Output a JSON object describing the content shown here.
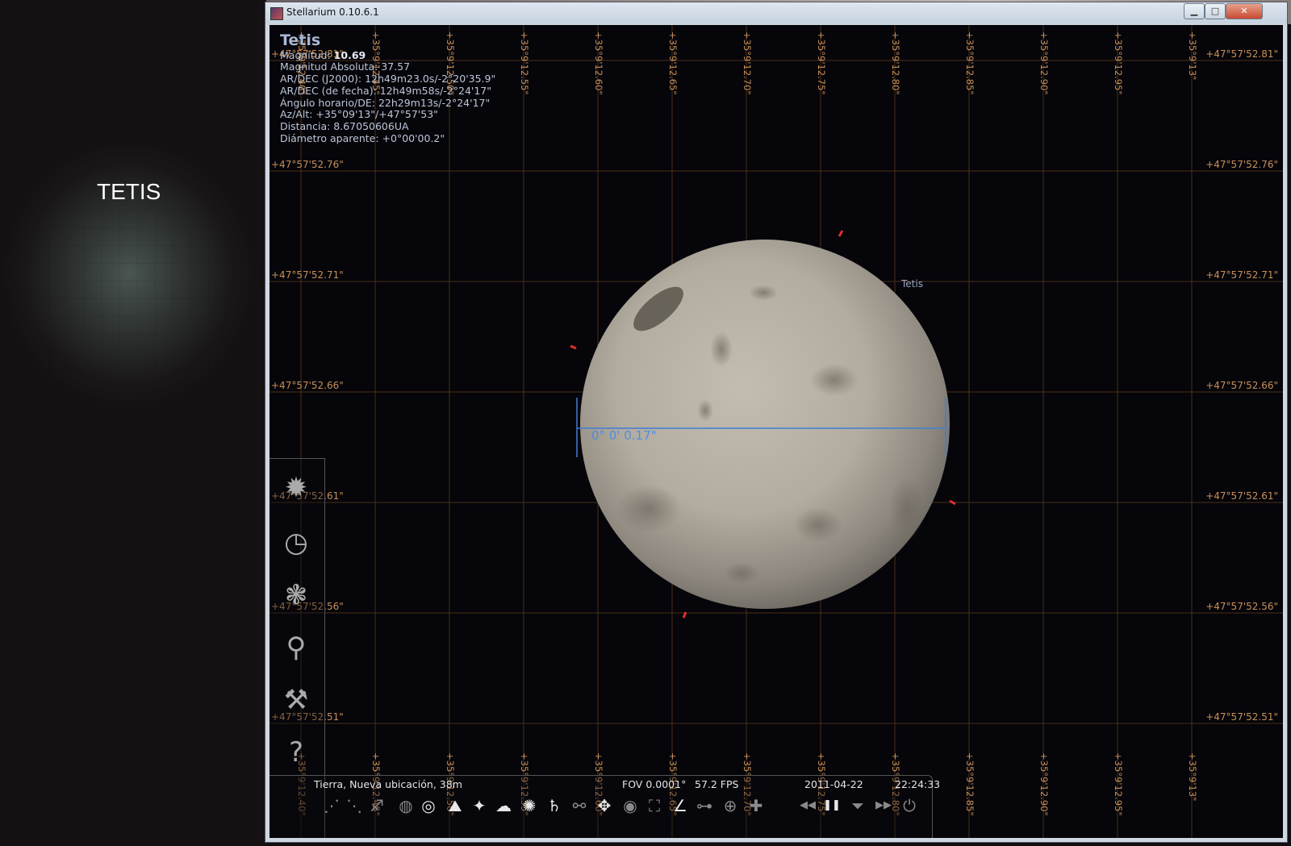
{
  "left_panel": {
    "title": "TETIS"
  },
  "window": {
    "title": "Stellarium 0.10.6.1",
    "min_label": "▁",
    "max_label": "□",
    "close_label": "✕"
  },
  "object_info": {
    "name": "Tetis",
    "magnitude_label": "Magnitud: ",
    "magnitude_value": "10.69",
    "lines": [
      "Magnitud Absoluta: 37.57",
      "AR/DEC (J2000): 12h49m23.0s/-2°20'35.9\"",
      "AR/DEC (de fecha): 12h49m58s/-2°24'17\"",
      "Ángulo horario/DE: 22h29m13s/-2°24'17\"",
      "Az/Alt: +35°09'13\"/+47°57'53\"",
      "Distancia: 8.67050606UA",
      "Diámetro aparente: +0°00'00.2\""
    ]
  },
  "sky": {
    "object_label": "Tetis",
    "measurement": "0° 0' 0.17\"",
    "alt_grid_labels": [
      "+47°57'52.81\"",
      "+47°57'52.76\"",
      "+47°57'52.71\"",
      "+47°57'52.66\"",
      "+47°57'52.61\"",
      "+47°57'52.56\"",
      "+47°57'52.51\""
    ],
    "az_grid_labels": [
      "+35°9'12.40\"",
      "+35°9'12.45\"",
      "+35°9'12.50\"",
      "+35°9'12.55\"",
      "+35°9'12.60\"",
      "+35°9'12.65\"",
      "+35°9'12.70\"",
      "+35°9'12.75\"",
      "+35°9'12.80\"",
      "+35°9'12.85\"",
      "+35°9'12.90\"",
      "+35°9'12.95\"",
      "+35°9'13\""
    ],
    "colors": {
      "grid_line": "#4a3018",
      "grid_label": "#c89058",
      "measure": "#3f7fd6",
      "marker": "#e03030"
    }
  },
  "sidebar": {
    "items": [
      {
        "name": "location-window-icon",
        "glyph": "✹"
      },
      {
        "name": "date-time-window-icon",
        "glyph": "◷"
      },
      {
        "name": "sky-viewing-options-icon",
        "glyph": "❃"
      },
      {
        "name": "search-window-icon",
        "glyph": "⚲"
      },
      {
        "name": "configuration-window-icon",
        "glyph": "⚒"
      },
      {
        "name": "help-window-icon",
        "glyph": "?"
      }
    ]
  },
  "status": {
    "location": "Tierra, Nueva ubicación, 38m",
    "fov": "FOV 0.0001°",
    "fps": "57.2 FPS",
    "date": "2011-04-22",
    "time": "22:24:33"
  },
  "toolbar": {
    "buttons": [
      {
        "name": "constellation-lines-icon",
        "glyph": "⋰",
        "on": false
      },
      {
        "name": "constellation-labels-icon",
        "glyph": "⋱",
        "on": false
      },
      {
        "name": "constellation-art-icon",
        "glyph": "♐",
        "on": false
      },
      {
        "name": "equatorial-grid-icon",
        "glyph": "◍",
        "on": false
      },
      {
        "name": "azimuthal-grid-icon",
        "glyph": "◎",
        "on": true
      },
      {
        "name": "ground-icon",
        "glyph": "⛰",
        "on": true
      },
      {
        "name": "cardinal-points-icon",
        "glyph": "✦",
        "on": true
      },
      {
        "name": "atmosphere-icon",
        "glyph": "☁",
        "on": true
      },
      {
        "name": "nebulas-icon",
        "glyph": "✺",
        "on": true
      },
      {
        "name": "planet-labels-icon",
        "glyph": "♄",
        "on": true
      },
      {
        "name": "equatorial-mount-icon",
        "glyph": "⚯",
        "on": false
      },
      {
        "name": "center-selected-icon",
        "glyph": "✥",
        "on": true
      },
      {
        "name": "night-mode-icon",
        "glyph": "◉",
        "on": false
      },
      {
        "name": "fullscreen-icon",
        "glyph": "⛶",
        "on": false
      },
      {
        "name": "angle-measure-icon",
        "glyph": "∠",
        "on": true
      },
      {
        "name": "distance-measure-icon",
        "glyph": "⊶",
        "on": false
      },
      {
        "name": "ocular-icon",
        "glyph": "⊕",
        "on": false
      },
      {
        "name": "telescope-icon",
        "glyph": "✚",
        "on": false
      },
      {
        "name": "decrease-time-speed-icon",
        "glyph": "◀◀",
        "on": false
      },
      {
        "name": "pause-icon",
        "glyph": "❚❚",
        "on": true
      },
      {
        "name": "real-time-icon",
        "glyph": "⏷",
        "on": false
      },
      {
        "name": "increase-time-speed-icon",
        "glyph": "▶▶",
        "on": false
      },
      {
        "name": "quit-icon",
        "glyph": "⏻",
        "on": false
      }
    ]
  }
}
